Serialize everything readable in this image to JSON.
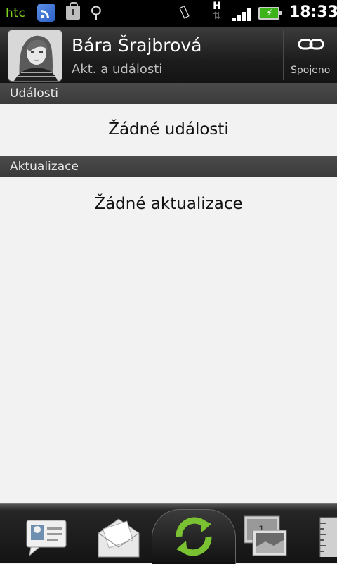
{
  "status_bar": {
    "brand": "htc",
    "icons": [
      "rss-icon",
      "market-icon",
      "usb-icon",
      "vibrate-icon",
      "hspa-icon",
      "signal-icon",
      "battery-charging-icon"
    ],
    "network": "H",
    "time": "18:33"
  },
  "header": {
    "name": "Bára Šrajbrová",
    "subtitle": "Akt. a události",
    "link_label": "Spojeno"
  },
  "sections": [
    {
      "title": "Události",
      "empty_text": "Žádné události"
    },
    {
      "title": "Aktualizace",
      "empty_text": "Žádné aktualizace"
    }
  ],
  "bottom_tabs": [
    {
      "icon": "contact-card-icon"
    },
    {
      "icon": "envelope-icon"
    },
    {
      "icon": "sync-updates-icon",
      "selected": true
    },
    {
      "icon": "photo-album-icon"
    },
    {
      "icon": "ruler-icon"
    }
  ],
  "colors": {
    "accent_green": "#7ac231",
    "background": "#f2f2f2",
    "header_dark": "#1c1c1c"
  }
}
